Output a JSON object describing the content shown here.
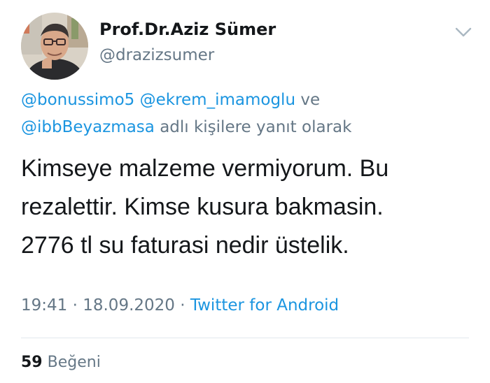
{
  "author": {
    "display_name": "Prof.Dr.Aziz Sümer",
    "handle": "@drazizsumer"
  },
  "reply_context": {
    "mentions": [
      "@bonussimo5",
      "@ekrem_imamoglu",
      "@ibbBeyazmasa"
    ],
    "connector": "ve",
    "suffix": "adlı kişilere yanıt olarak"
  },
  "tweet": {
    "text": "Kimseye malzeme vermiyorum. Bu\nrezalettir. Kimse kusura bakmasin.\n2776 tl su faturasi nedir üstelik."
  },
  "meta": {
    "time": "19:41",
    "separator": "·",
    "date": "18.09.2020",
    "source": "Twitter for Android"
  },
  "stats": {
    "likes_count": "59",
    "likes_label": "Beğeni"
  },
  "icons": {
    "menu": "chevron-down-icon",
    "avatar": "profile-photo"
  },
  "colors": {
    "link": "#1b95e0",
    "muted": "#657786",
    "text": "#14171a",
    "divider": "#e1e8ed"
  }
}
